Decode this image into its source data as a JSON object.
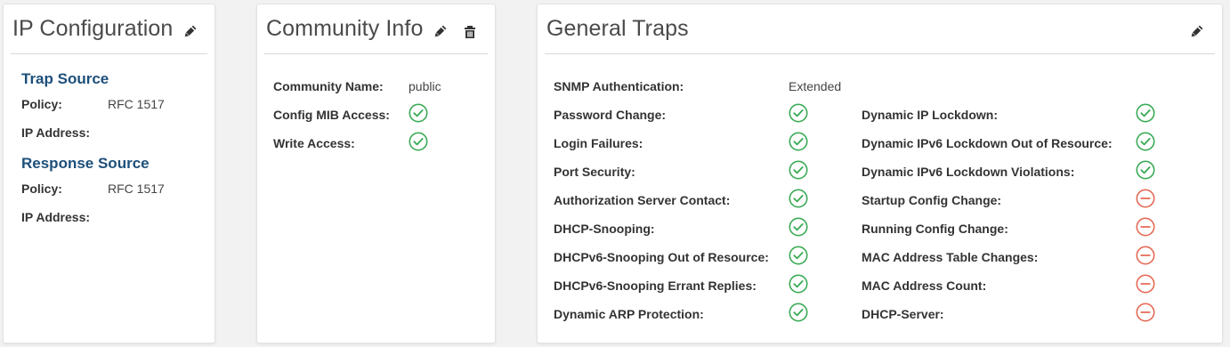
{
  "ip_config": {
    "title": "IP Configuration",
    "edit_icon": "pencil-icon",
    "trap_source": {
      "heading": "Trap Source",
      "policy_label": "Policy:",
      "policy_value": "RFC 1517",
      "ip_label": "IP Address:",
      "ip_value": ""
    },
    "response_source": {
      "heading": "Response Source",
      "policy_label": "Policy:",
      "policy_value": "RFC 1517",
      "ip_label": "IP Address:",
      "ip_value": ""
    }
  },
  "community": {
    "title": "Community Info",
    "edit_icon": "pencil-icon",
    "delete_icon": "trash-icon",
    "name_label": "Community Name:",
    "name_value": "public",
    "config_mib_label": "Config MIB Access:",
    "config_mib_state": "enabled",
    "write_label": "Write Access:",
    "write_state": "enabled"
  },
  "traps": {
    "title": "General Traps",
    "edit_icon": "pencil-icon",
    "snmp_auth_label": "SNMP Authentication:",
    "snmp_auth_value": "Extended",
    "left": [
      {
        "label": "Password Change:",
        "state": "enabled"
      },
      {
        "label": "Login Failures:",
        "state": "enabled"
      },
      {
        "label": "Port Security:",
        "state": "enabled"
      },
      {
        "label": "Authorization Server Contact:",
        "state": "enabled"
      },
      {
        "label": "DHCP-Snooping:",
        "state": "enabled"
      },
      {
        "label": "DHCPv6-Snooping Out of Resource:",
        "state": "enabled"
      },
      {
        "label": "DHCPv6-Snooping Errant Replies:",
        "state": "enabled"
      },
      {
        "label": "Dynamic ARP Protection:",
        "state": "enabled"
      }
    ],
    "right": [
      {
        "label": "Dynamic IP Lockdown:",
        "state": "enabled"
      },
      {
        "label": "Dynamic IPv6 Lockdown Out of Resource:",
        "state": "enabled"
      },
      {
        "label": "Dynamic IPv6 Lockdown Violations:",
        "state": "enabled"
      },
      {
        "label": "Startup Config Change:",
        "state": "disabled"
      },
      {
        "label": "Running Config Change:",
        "state": "disabled"
      },
      {
        "label": "MAC Address Table Changes:",
        "state": "disabled"
      },
      {
        "label": "MAC Address Count:",
        "state": "disabled"
      },
      {
        "label": "DHCP-Server:",
        "state": "disabled"
      }
    ]
  },
  "colors": {
    "enabled": "#3aaa55",
    "disabled": "#e56a55",
    "section_heading": "#1d4f7a"
  }
}
